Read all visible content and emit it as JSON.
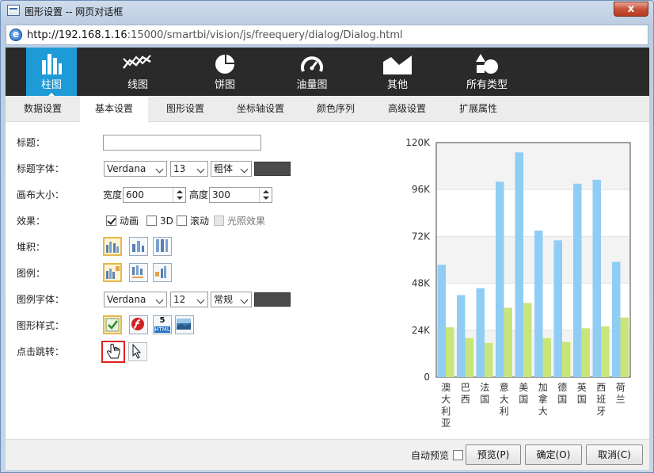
{
  "window": {
    "title": "图形设置 -- 网页对话框",
    "close_label": "x"
  },
  "address": {
    "host": "http://192.168.1.16",
    "path": ":15000/smartbi/vision/js/freequery/dialog/Dialog.html"
  },
  "nav": {
    "items": [
      {
        "label": "柱图",
        "icon": "bar-chart-icon",
        "active": true
      },
      {
        "label": "线图",
        "icon": "line-chart-icon",
        "active": false
      },
      {
        "label": "饼图",
        "icon": "pie-chart-icon",
        "active": false
      },
      {
        "label": "油量图",
        "icon": "gauge-icon",
        "active": false
      },
      {
        "label": "其他",
        "icon": "area-chart-icon",
        "active": false
      },
      {
        "label": "所有类型",
        "icon": "shapes-icon",
        "active": false
      }
    ]
  },
  "tabs": [
    "数据设置",
    "基本设置",
    "图形设置",
    "坐标轴设置",
    "颜色序列",
    "高级设置",
    "扩展属性"
  ],
  "active_tab": 1,
  "form": {
    "title_label": "标题：",
    "title_value": "",
    "title_font_label": "标题字体：",
    "title_font": "Verdana",
    "title_size": "13",
    "title_weight": "粗体",
    "title_color": "#4b4b4b",
    "canvas_label": "画布大小：",
    "width_label": "宽度",
    "width_value": "600",
    "height_label": "高度",
    "height_value": "300",
    "effect_label": "效果：",
    "effects": [
      {
        "label": "动画",
        "checked": true,
        "disabled": false
      },
      {
        "label": "3D",
        "checked": false,
        "disabled": false
      },
      {
        "label": "滚动",
        "checked": false,
        "disabled": false
      },
      {
        "label": "光照效果",
        "checked": false,
        "disabled": true
      }
    ],
    "stack_label": "堆积：",
    "legend_label": "图例：",
    "legend_font_label": "图例字体：",
    "legend_font": "Verdana",
    "legend_size": "12",
    "legend_weight": "常规",
    "legend_color": "#4b4b4b",
    "style_label": "图形样式：",
    "html5_text": "5",
    "html5_sub": "HTML",
    "click_label": "点击跳转："
  },
  "chart_data": {
    "type": "bar",
    "categories": [
      "澳大利亚",
      "巴西",
      "法国",
      "意大利",
      "美国",
      "加拿大",
      "德国",
      "英国",
      "西班牙",
      "荷兰"
    ],
    "series": [
      {
        "color": "#8fcdf5",
        "values": [
          57500,
          42000,
          45500,
          100000,
          115000,
          75000,
          70000,
          99000,
          101000,
          59000
        ]
      },
      {
        "color": "#c8e57a",
        "values": [
          25500,
          20000,
          17500,
          35500,
          38000,
          20000,
          18000,
          25000,
          26000,
          30500
        ]
      }
    ],
    "yticks": [
      "0",
      "24K",
      "48K",
      "72K",
      "96K",
      "120K"
    ],
    "ylim": [
      0,
      120000
    ]
  },
  "bottom": {
    "auto_preview_label": "自动预览",
    "preview_label": "预览(P)",
    "ok_label": "确定(O)",
    "cancel_label": "取消(C)"
  }
}
